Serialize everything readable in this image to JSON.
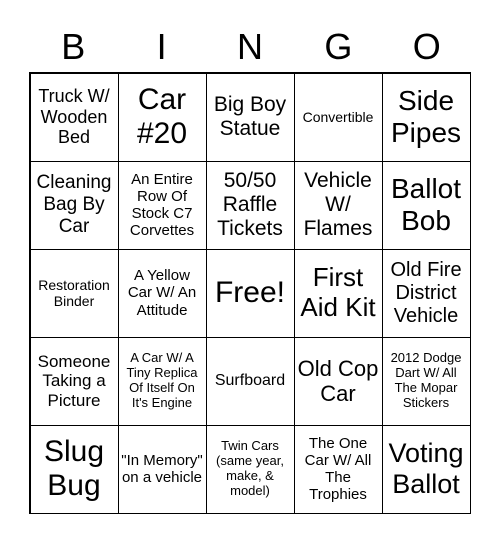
{
  "header": [
    "B",
    "I",
    "N",
    "G",
    "O"
  ],
  "cells": [
    "Truck W/ Wooden Bed",
    "Car #20",
    "Big Boy Statue",
    "Convertible",
    "Side Pipes",
    "Cleaning Bag By Car",
    "An Entire Row Of Stock C7 Corvettes",
    "50/50 Raffle Tickets",
    "Vehicle W/ Flames",
    "Ballot Bob",
    "Restoration Binder",
    "A Yellow Car W/ An Attitude",
    "Free!",
    "First Aid Kit",
    "Old Fire District Vehicle",
    "Someone Taking a Picture",
    "A Car W/ A Tiny Replica Of Itself On It's Engine",
    "Surfboard",
    "Old Cop Car",
    "2012 Dodge Dart W/ All The Mopar Stickers",
    "Slug Bug",
    "\"In Memory\" on a vehicle",
    "Twin Cars (same year, make, & model)",
    "The One Car W/ All The Trophies",
    "Voting Ballot"
  ]
}
